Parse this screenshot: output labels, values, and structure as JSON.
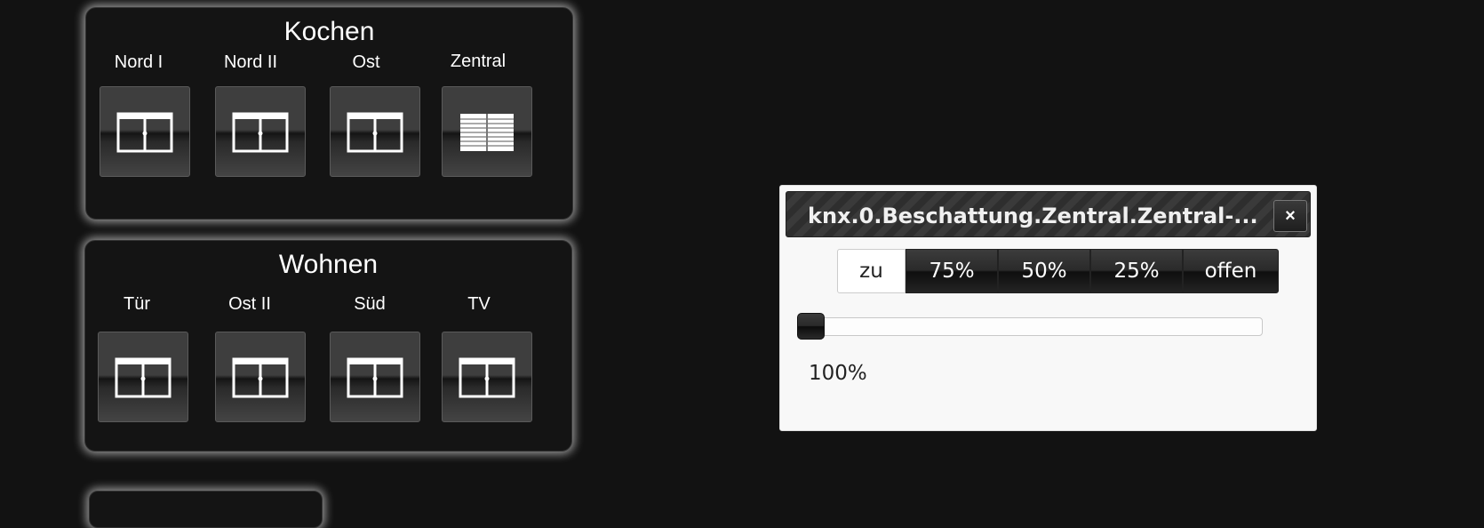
{
  "colors": {
    "background": "#121212",
    "panel": "#141414",
    "panel_glow": "#ffffff",
    "dialog_bg": "#f8f8f8",
    "active_segment": "#ffffff"
  },
  "panels": [
    {
      "title": "Kochen",
      "windows": [
        {
          "label": "Nord I",
          "icon": "window-double-icon"
        },
        {
          "label": "Nord II",
          "icon": "window-double-icon"
        },
        {
          "label": "Ost",
          "icon": "window-double-icon"
        },
        {
          "label": "Zentral",
          "icon": "blinds-closed-icon"
        }
      ]
    },
    {
      "title": "Wohnen",
      "windows": [
        {
          "label": "Tür",
          "icon": "window-double-icon"
        },
        {
          "label": "Ost II",
          "icon": "window-double-icon"
        },
        {
          "label": "Süd",
          "icon": "window-double-icon"
        },
        {
          "label": "TV",
          "icon": "window-double-icon"
        }
      ]
    }
  ],
  "dialog": {
    "title": "knx.0.Beschattung.Zentral.Zentral-...",
    "close_label": "×",
    "buttons": [
      "zu",
      "75%",
      "50%",
      "25%",
      "offen"
    ],
    "active_button": "zu",
    "slider_value": 100,
    "slider_fraction": 0.0,
    "value_text": "100%"
  }
}
